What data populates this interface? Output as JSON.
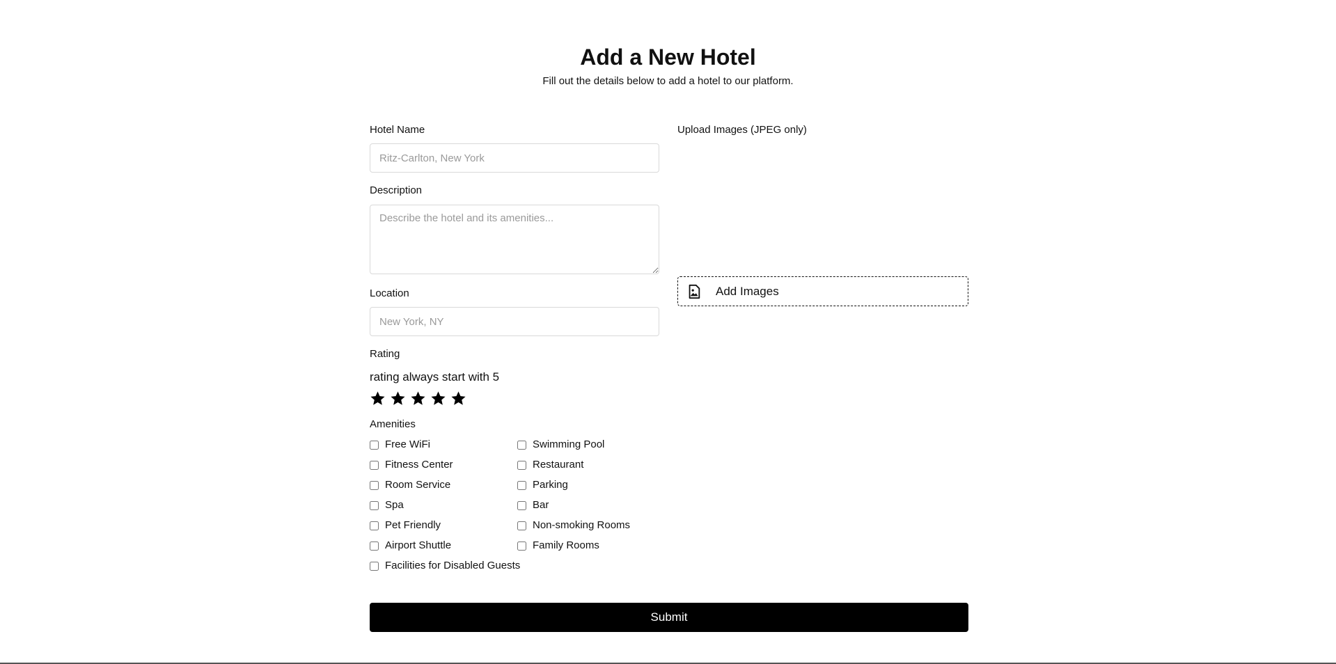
{
  "header": {
    "title": "Add a New Hotel",
    "subtitle": "Fill out the details below to add a hotel to our platform."
  },
  "form": {
    "hotel_name": {
      "label": "Hotel Name",
      "placeholder": "Ritz-Carlton, New York",
      "value": ""
    },
    "description": {
      "label": "Description",
      "placeholder": "Describe the hotel and its amenities...",
      "value": ""
    },
    "location": {
      "label": "Location",
      "placeholder": "New York, NY",
      "value": ""
    },
    "rating": {
      "label": "Rating",
      "helper": "rating always start with 5",
      "value": 5,
      "max": 5
    },
    "amenities": {
      "label": "Amenities",
      "items": [
        "Free WiFi",
        "Swimming Pool",
        "Fitness Center",
        "Restaurant",
        "Room Service",
        "Parking",
        "Spa",
        "Bar",
        "Pet Friendly",
        "Non-smoking Rooms",
        "Airport Shuttle",
        "Family Rooms",
        "Facilities for Disabled Guests"
      ]
    },
    "upload": {
      "label": "Upload Images (JPEG only)",
      "button_label": "Add Images",
      "icon": "image-file-icon"
    },
    "submit_label": "Submit"
  },
  "colors": {
    "primary": "#000000",
    "border": "#d9d9d9",
    "placeholder": "#9a9a9a"
  }
}
